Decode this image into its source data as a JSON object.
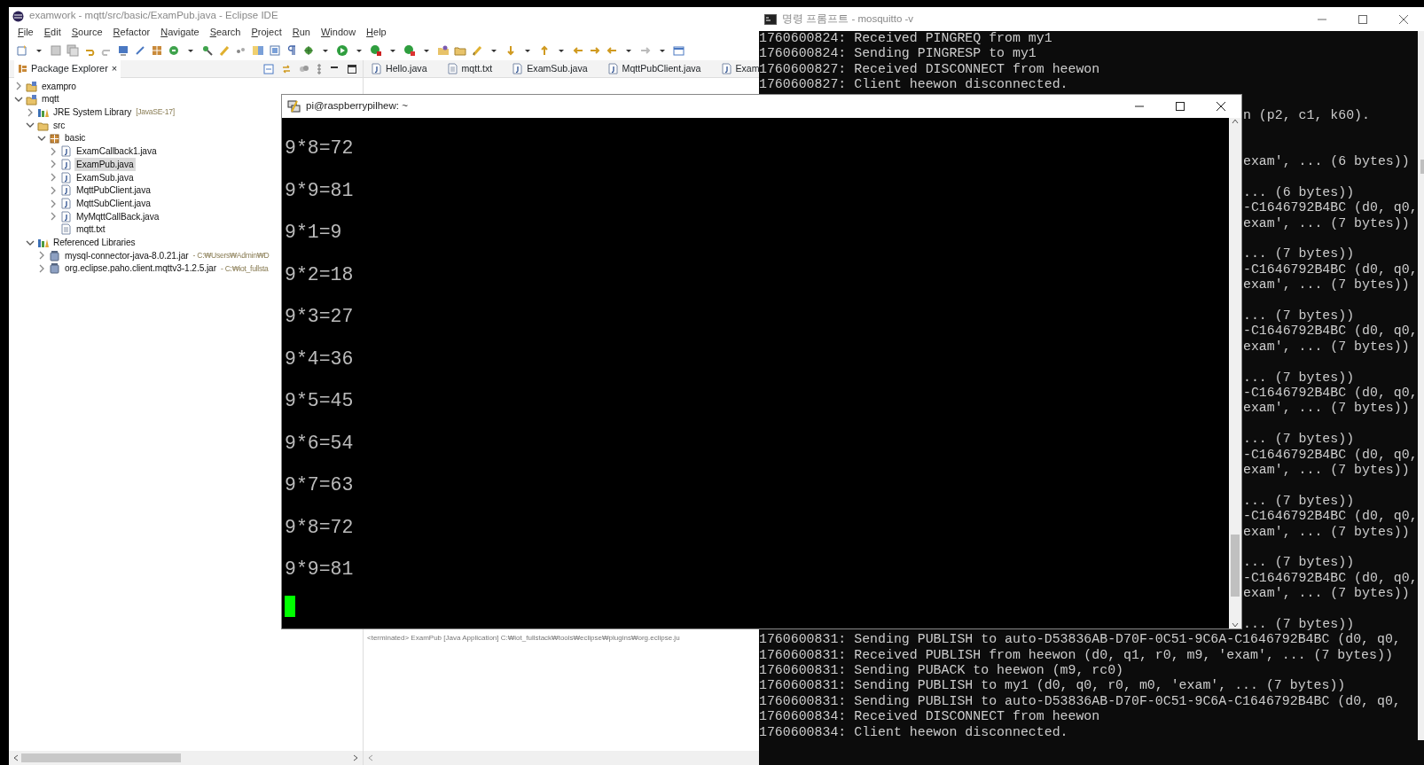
{
  "eclipse": {
    "title": "examwork - mqtt/src/basic/ExamPub.java - Eclipse IDE",
    "menu": [
      "File",
      "Edit",
      "Source",
      "Refactor",
      "Navigate",
      "Search",
      "Project",
      "Run",
      "Window",
      "Help"
    ],
    "explorer": {
      "title": "Package Explorer",
      "close": "×",
      "tree": [
        {
          "label": "exampro",
          "kind": "project",
          "expanded": false,
          "selected": false
        },
        {
          "label": "mqtt",
          "kind": "project",
          "expanded": true,
          "selected": false,
          "children": [
            {
              "label": "JRE System Library",
              "decoration": "[JavaSE-17]",
              "kind": "library",
              "expanded": false,
              "selected": false
            },
            {
              "label": "src",
              "kind": "folder",
              "expanded": true,
              "selected": false,
              "children": [
                {
                  "label": "basic",
                  "kind": "package",
                  "expanded": true,
                  "selected": false,
                  "children": [
                    {
                      "label": "ExamCallback1.java",
                      "kind": "java",
                      "expanded": false,
                      "selected": false
                    },
                    {
                      "label": "ExamPub.java",
                      "kind": "java",
                      "expanded": false,
                      "selected": true
                    },
                    {
                      "label": "ExamSub.java",
                      "kind": "java",
                      "expanded": false,
                      "selected": false
                    },
                    {
                      "label": "MqttPubClient.java",
                      "kind": "java",
                      "expanded": false,
                      "selected": false
                    },
                    {
                      "label": "MqttSubClient.java",
                      "kind": "java",
                      "expanded": false,
                      "selected": false
                    },
                    {
                      "label": "MyMqttCallBack.java",
                      "kind": "java",
                      "expanded": false,
                      "selected": false
                    },
                    {
                      "label": "mqtt.txt",
                      "kind": "text",
                      "selected": false
                    }
                  ]
                }
              ]
            },
            {
              "label": "Referenced Libraries",
              "kind": "library",
              "expanded": true,
              "selected": false,
              "children": [
                {
                  "label": "mysql-connector-java-8.0.21.jar",
                  "decoration": "- C:₩Users₩Admin₩D",
                  "kind": "jar",
                  "expanded": false,
                  "selected": false
                },
                {
                  "label": "org.eclipse.paho.client.mqttv3-1.2.5.jar",
                  "decoration": "- C:₩iot_fullsta",
                  "kind": "jar",
                  "expanded": false,
                  "selected": false
                }
              ]
            }
          ]
        }
      ]
    },
    "editor_tabs": [
      {
        "label": "Hello.java",
        "kind": "java"
      },
      {
        "label": "mqtt.txt",
        "kind": "text"
      },
      {
        "label": "ExamSub.java",
        "kind": "java"
      },
      {
        "label": "MqttPubClient.java",
        "kind": "java"
      },
      {
        "label": "Exam",
        "kind": "java"
      }
    ],
    "console_line": "<terminated> ExamPub [Java Application] C:₩iot_fullstack₩tools₩eclipse₩plugins₩org.eclipse.ju"
  },
  "cmd": {
    "title": "명령 프롬프트 - mosquitto  -v",
    "lines": [
      {
        "kind": "full",
        "text": "1760600824: Received PINGREQ from my1"
      },
      {
        "kind": "full",
        "text": "1760600824: Sending PINGRESP to my1"
      },
      {
        "kind": "full",
        "text": "1760600827: Received DISCONNECT from heewon"
      },
      {
        "kind": "full",
        "text": "1760600827: Client heewon disconnected."
      },
      {
        "kind": "blank"
      },
      {
        "kind": "tail",
        "text": "n (p2, c1, k60)."
      },
      {
        "kind": "blank"
      },
      {
        "kind": "blank"
      },
      {
        "kind": "tail",
        "text": "exam', ... (6 bytes))"
      },
      {
        "kind": "blank"
      },
      {
        "kind": "tail",
        "text": "... (6 bytes))"
      },
      {
        "kind": "tail",
        "text": "-C1646792B4BC (d0, q0,"
      },
      {
        "kind": "tail",
        "text": "exam', ... (7 bytes))"
      },
      {
        "kind": "blank"
      },
      {
        "kind": "tail",
        "text": "... (7 bytes))"
      },
      {
        "kind": "tail",
        "text": "-C1646792B4BC (d0, q0,"
      },
      {
        "kind": "tail",
        "text": "exam', ... (7 bytes))"
      },
      {
        "kind": "blank"
      },
      {
        "kind": "tail",
        "text": "... (7 bytes))"
      },
      {
        "kind": "tail",
        "text": "-C1646792B4BC (d0, q0,"
      },
      {
        "kind": "tail",
        "text": "exam', ... (7 bytes))"
      },
      {
        "kind": "blank"
      },
      {
        "kind": "tail",
        "text": "... (7 bytes))"
      },
      {
        "kind": "tail",
        "text": "-C1646792B4BC (d0, q0,"
      },
      {
        "kind": "tail",
        "text": "exam', ... (7 bytes))"
      },
      {
        "kind": "blank"
      },
      {
        "kind": "tail",
        "text": "... (7 bytes))"
      },
      {
        "kind": "tail",
        "text": "-C1646792B4BC (d0, q0,"
      },
      {
        "kind": "tail",
        "text": "exam', ... (7 bytes))"
      },
      {
        "kind": "blank"
      },
      {
        "kind": "tail",
        "text": "... (7 bytes))"
      },
      {
        "kind": "tail",
        "text": "-C1646792B4BC (d0, q0,"
      },
      {
        "kind": "tail",
        "text": "exam', ... (7 bytes))"
      },
      {
        "kind": "blank"
      },
      {
        "kind": "tail",
        "text": "... (7 bytes))"
      },
      {
        "kind": "tail",
        "text": "-C1646792B4BC (d0, q0,"
      },
      {
        "kind": "tail",
        "text": "exam', ... (7 bytes))"
      },
      {
        "kind": "blank"
      },
      {
        "kind": "tail",
        "text": "... (7 bytes))"
      },
      {
        "kind": "full",
        "text": "1760600831: Sending PUBLISH to auto-D53836AB-D70F-0C51-9C6A-C1646792B4BC (d0, q0,"
      },
      {
        "kind": "full",
        "text": "1760600831: Received PUBLISH from heewon (d0, q1, r0, m9, 'exam', ... (7 bytes))"
      },
      {
        "kind": "full",
        "text": "1760600831: Sending PUBACK to heewon (m9, rc0)"
      },
      {
        "kind": "full",
        "text": "1760600831: Sending PUBLISH to my1 (d0, q0, r0, m0, 'exam', ... (7 bytes))"
      },
      {
        "kind": "full",
        "text": "1760600831: Sending PUBLISH to auto-D53836AB-D70F-0C51-9C6A-C1646792B4BC (d0, q0,"
      },
      {
        "kind": "full",
        "text": "1760600834: Received DISCONNECT from heewon"
      },
      {
        "kind": "full",
        "text": "1760600834: Client heewon disconnected."
      }
    ]
  },
  "putty": {
    "title": "pi@raspberrypilhew: ~",
    "lines": [
      "9*8=72",
      "9*9=81",
      "9*1=9",
      "9*2=18",
      "9*3=27",
      "9*4=36",
      "9*5=45",
      "9*6=54",
      "9*7=63",
      "9*8=72",
      "9*9=81"
    ]
  }
}
